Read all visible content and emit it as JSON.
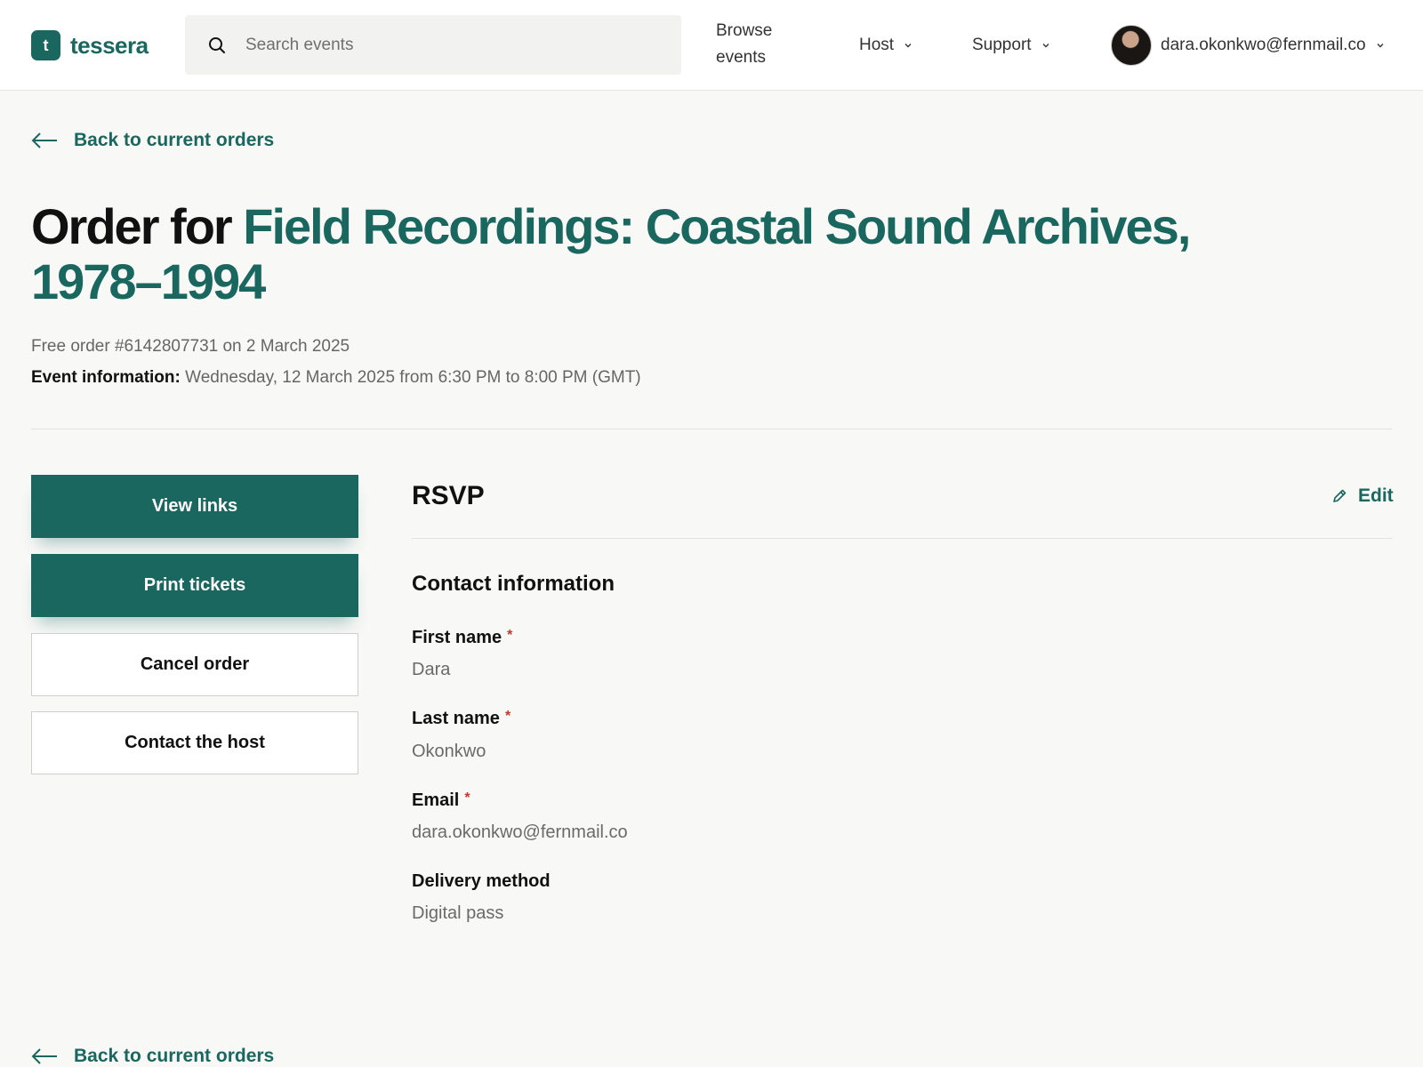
{
  "brand": {
    "logo_letter": "t",
    "name": "tessera",
    "color": "#19675e"
  },
  "search": {
    "placeholder": "Search events"
  },
  "nav": {
    "browse_line1": "Browse",
    "browse_line2": "events",
    "host": "Host",
    "support": "Support"
  },
  "account": {
    "email": "dara.okonkwo@fernmail.co"
  },
  "back_link": {
    "label": "Back to current orders"
  },
  "order": {
    "title_prefix": "Order for",
    "event_name": "Field Recordings: Coastal Sound Archives, 1978–1994",
    "order_line": "Free order #6142807731 on 2 March 2025",
    "event_info_label": "Event information:",
    "event_info_value": "Wednesday, 12 March 2025 from 6:30 PM to 8:00 PM (GMT)"
  },
  "actions": {
    "view_links": "View links",
    "print_tickets": "Print tickets",
    "cancel_order": "Cancel order",
    "contact_host": "Contact the host"
  },
  "rsvp": {
    "title": "RSVP",
    "edit_label": "Edit",
    "contact_section_title": "Contact information",
    "required_marker": "*",
    "fields": [
      {
        "label": "First name",
        "value": "Dara",
        "required": true
      },
      {
        "label": "Last name",
        "value": "Okonkwo",
        "required": true
      },
      {
        "label": "Email",
        "value": "dara.okonkwo@fernmail.co",
        "required": true
      },
      {
        "label": "Delivery method",
        "value": "Digital pass",
        "required": false
      }
    ]
  }
}
